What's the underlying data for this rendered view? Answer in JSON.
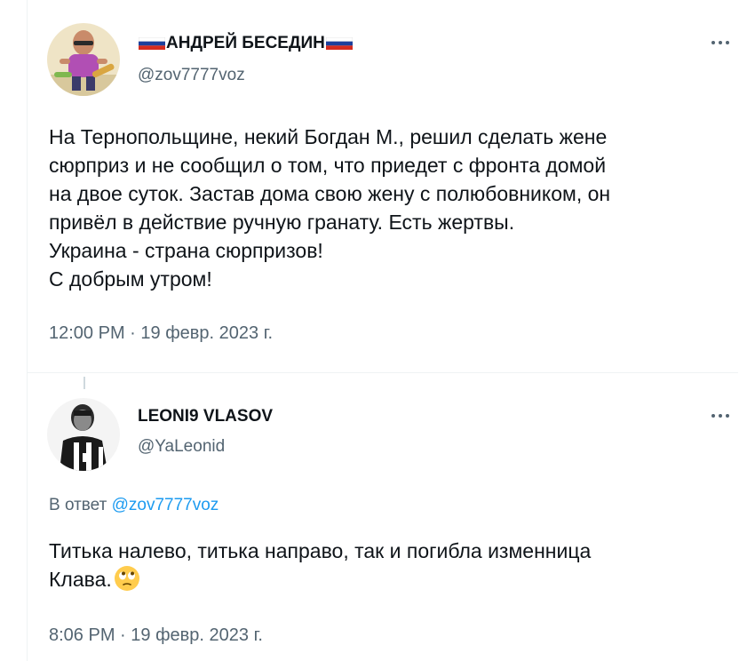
{
  "main_tweet": {
    "author": {
      "display_name": "АНДРЕЙ БЕСЕДИН",
      "handle": "@zov7777voz",
      "name_flags": "russia-flag"
    },
    "text_lines": [
      "На Тернопольщине, некий Богдан М., решил сделать жене",
      "сюрприз и не сообщил о том, что приедет с фронта домой",
      "на двое суток. Застав дома свою жену с полюбовником, он",
      "привёл в действие ручную гранату. Есть жертвы.",
      "Украина - страна сюрпризов!",
      "С добрым утром!"
    ],
    "time": "12:00 PM",
    "separator": "·",
    "date": "19 февр. 2023 г.",
    "more_icon": "more-icon"
  },
  "reply_tweet": {
    "author": {
      "display_name": "LEONI9 VLASOV",
      "handle": "@YaLeonid"
    },
    "reply_context": {
      "prefix": "В ответ",
      "mention": "@zov7777voz"
    },
    "text_lines": [
      "Титька налево, титька направо, так и погибла изменница",
      "Клава."
    ],
    "emoji": "face-with-rolling-eyes-emoji",
    "time": "8:06 PM",
    "separator": "·",
    "date": "19 февр. 2023 г.",
    "more_icon": "more-icon"
  },
  "colors": {
    "text_primary": "#0f1419",
    "text_secondary": "#536471",
    "link": "#1d9bf0",
    "divider": "#eff3f4"
  }
}
